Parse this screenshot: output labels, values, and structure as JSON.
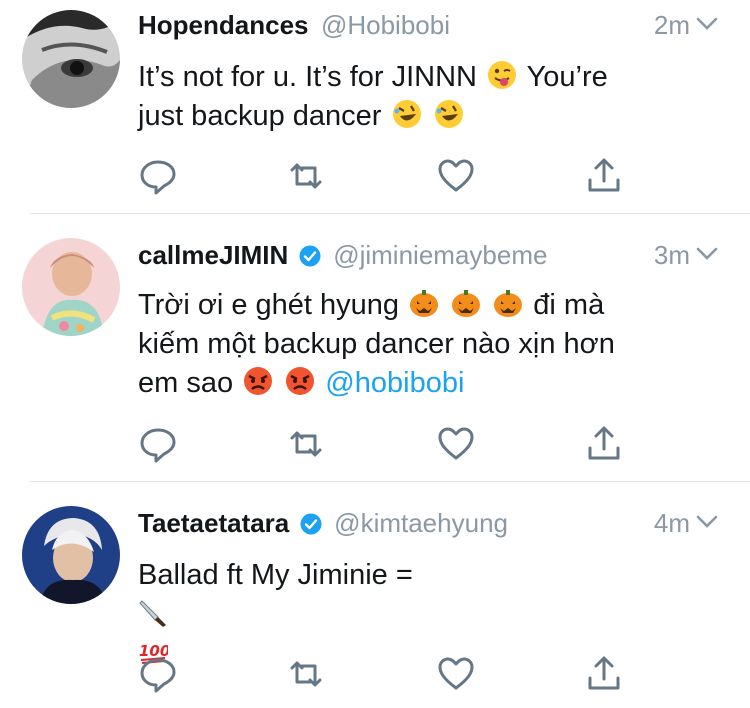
{
  "tweets": [
    {
      "display_name": "Hopendances",
      "handle": "@Hobibobi",
      "time": "2m",
      "verified": false,
      "body_lines": [
        "It’s not for u. It’s for JINNN",
        "You’re",
        "just backup dancer"
      ],
      "emojis": [
        "winking-tongue-face",
        "rolling-laughing-face",
        "rolling-laughing-face"
      ]
    },
    {
      "display_name": "callmeJIMIN",
      "handle": "@jiminiemaybeme",
      "time": "3m",
      "verified": true,
      "body_lines": [
        "Trời ơi e ghét hyung",
        "đi mà",
        "kiếm một backup dancer nào xịn hơn",
        "em sao"
      ],
      "mention": "@hobibobi",
      "emojis": [
        "jack-o-lantern",
        "jack-o-lantern",
        "jack-o-lantern",
        "angry-face",
        "angry-face"
      ]
    },
    {
      "display_name": "Taetaetatara",
      "handle": "@kimtaehyung",
      "time": "4m",
      "verified": true,
      "body_lines": [
        "Ballad ft My Jiminie ="
      ],
      "emojis": [
        "knife",
        "hundred-points"
      ]
    }
  ],
  "colors": {
    "accent": "#1da1f2",
    "muted": "#8b98a5",
    "divider": "#e1e8ed",
    "icon": "#657786"
  },
  "icons": [
    "reply-icon",
    "retweet-icon",
    "like-icon",
    "share-icon",
    "verified-badge-icon",
    "chevron-down-icon"
  ]
}
